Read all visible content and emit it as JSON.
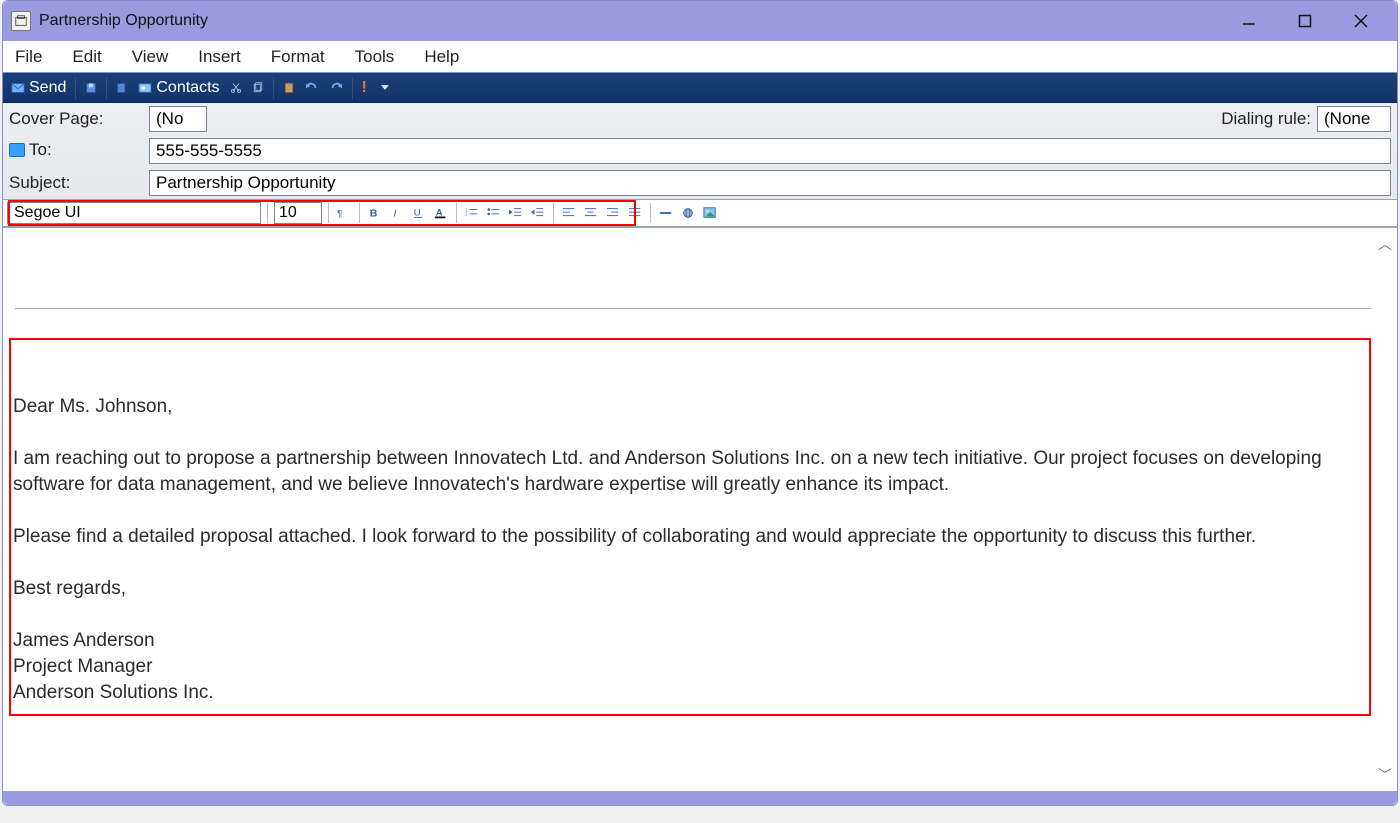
{
  "title": "Partnership Opportunity",
  "menubar": [
    "File",
    "Edit",
    "View",
    "Insert",
    "Format",
    "Tools",
    "Help"
  ],
  "actionbar": {
    "send": "Send",
    "contacts": "Contacts"
  },
  "header": {
    "cover_label": "Cover Page:",
    "cover_value": "(No",
    "dialing_label": "Dialing rule:",
    "dialing_value": "(None",
    "to_label": "To:",
    "to_value": "555-555-5555",
    "subject_label": "Subject:",
    "subject_value": "Partnership Opportunity"
  },
  "format": {
    "font": "Segoe UI",
    "size": "10"
  },
  "body": {
    "greeting": "Dear Ms. Johnson,",
    "p1": "I am reaching out to propose a partnership between Innovatech Ltd. and Anderson Solutions Inc. on a new tech initiative. Our project focuses on developing software for data management, and we believe Innovatech's hardware expertise will greatly enhance its impact.",
    "p2": "Please find a detailed proposal attached. I look forward to the possibility of collaborating and would appreciate the opportunity to discuss this further.",
    "closing": "Best regards,",
    "sig1": "James Anderson",
    "sig2": "Project Manager",
    "sig3": "Anderson Solutions Inc."
  }
}
